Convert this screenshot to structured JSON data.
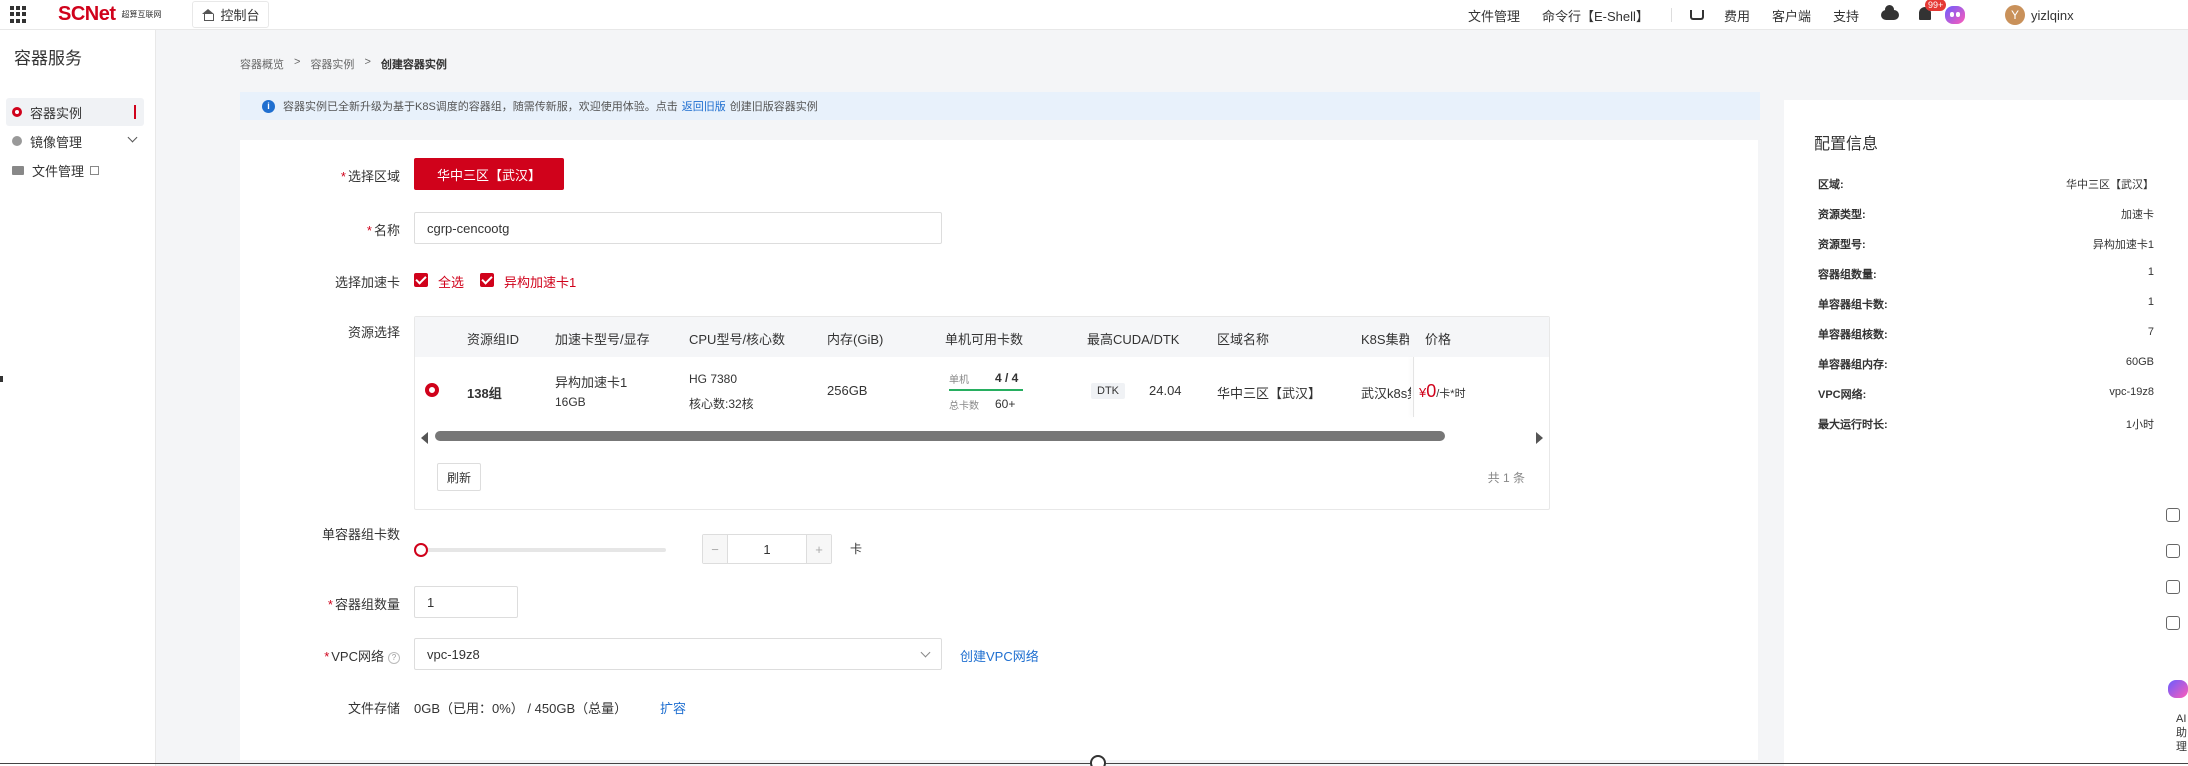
{
  "topbar": {
    "brand": "SCNet",
    "brand_sub": "超算互联网",
    "console": "控制台",
    "nav": [
      "文件管理",
      "命令行【E-Shell】",
      "费用",
      "客户端",
      "支持"
    ],
    "badge": "99+",
    "avatar": "Y",
    "username": "yizlqinx"
  },
  "sidebar": {
    "title": "容器服务",
    "items": [
      {
        "label": "容器实例",
        "icon": "container-dot-icon"
      },
      {
        "label": "镜像管理",
        "icon": "image-dot-icon"
      },
      {
        "label": "文件管理",
        "icon": "folder-icon"
      }
    ]
  },
  "breadcrumb": [
    "容器概览",
    "容器实例",
    "创建容器实例"
  ],
  "notice": {
    "text": "容器实例已全新升级为基于K8S调度的容器组，随需传新服，欢迎使用体验。点击",
    "link": "返回旧版",
    "suffix": "创建旧版容器实例"
  },
  "form": {
    "region_label": "选择区域",
    "region_value": "华中三区【武汉】",
    "name_label": "名称",
    "name_value": "cgrp-cencootg",
    "accel_label": "选择加速卡",
    "select_all": "全选",
    "accel_option": "异构加速卡1",
    "resource_label": "资源选择",
    "table": {
      "headers": [
        "资源组ID",
        "加速卡型号/显存",
        "CPU型号/核心数",
        "内存(GiB)",
        "单机可用卡数",
        "最高CUDA/DTK",
        "区域名称",
        "K8S集群",
        "价格"
      ],
      "row": {
        "id": "138组",
        "accel_model": "异构加速卡1",
        "accel_mem": "16GB",
        "cpu_model": "HG 7380",
        "cpu_cores": "核心数:32核",
        "memory": "256GB",
        "single_label": "单机",
        "single_value": "4 / 4",
        "total_label": "总卡数",
        "total_value": "60+",
        "dtk_tag": "DTK",
        "dtk_version": "24.04",
        "region": "华中三区【武汉】",
        "k8s": "武汉k8s集",
        "price_symbol": "¥",
        "price_value": "0",
        "price_unit": "/卡*时"
      }
    },
    "refresh": "刷新",
    "total": "共 1 条",
    "cards_label": "单容器组卡数",
    "cards_value": "1",
    "cards_unit": "卡",
    "slider_fraction": 0.0,
    "count_label": "容器组数量",
    "count_value": "1",
    "vpc_label": "VPC网络",
    "vpc_value": "vpc-19z8",
    "vpc_create": "创建VPC网络",
    "storage_label": "文件存储",
    "storage_value": "0GB（已用：0%） / 450GB（总量）",
    "storage_expand": "扩容"
  },
  "config": {
    "title": "配置信息",
    "rows": [
      {
        "k": "区域:",
        "v": "华中三区【武汉】"
      },
      {
        "k": "资源类型:",
        "v": "加速卡"
      },
      {
        "k": "资源型号:",
        "v": "异构加速卡1"
      },
      {
        "k": "容器组数量:",
        "v": "1"
      },
      {
        "k": "单容器组卡数:",
        "v": "1"
      },
      {
        "k": "单容器组核数:",
        "v": "7"
      },
      {
        "k": "单容器组内存:",
        "v": "60GB"
      },
      {
        "k": "VPC网络:",
        "v": "vpc-19z8"
      },
      {
        "k": "最大运行时长:",
        "v": "1小时"
      }
    ]
  },
  "assistant": {
    "label": "AI助理"
  },
  "colors": {
    "accent": "#d0021b",
    "link": "#1f6fd0"
  }
}
